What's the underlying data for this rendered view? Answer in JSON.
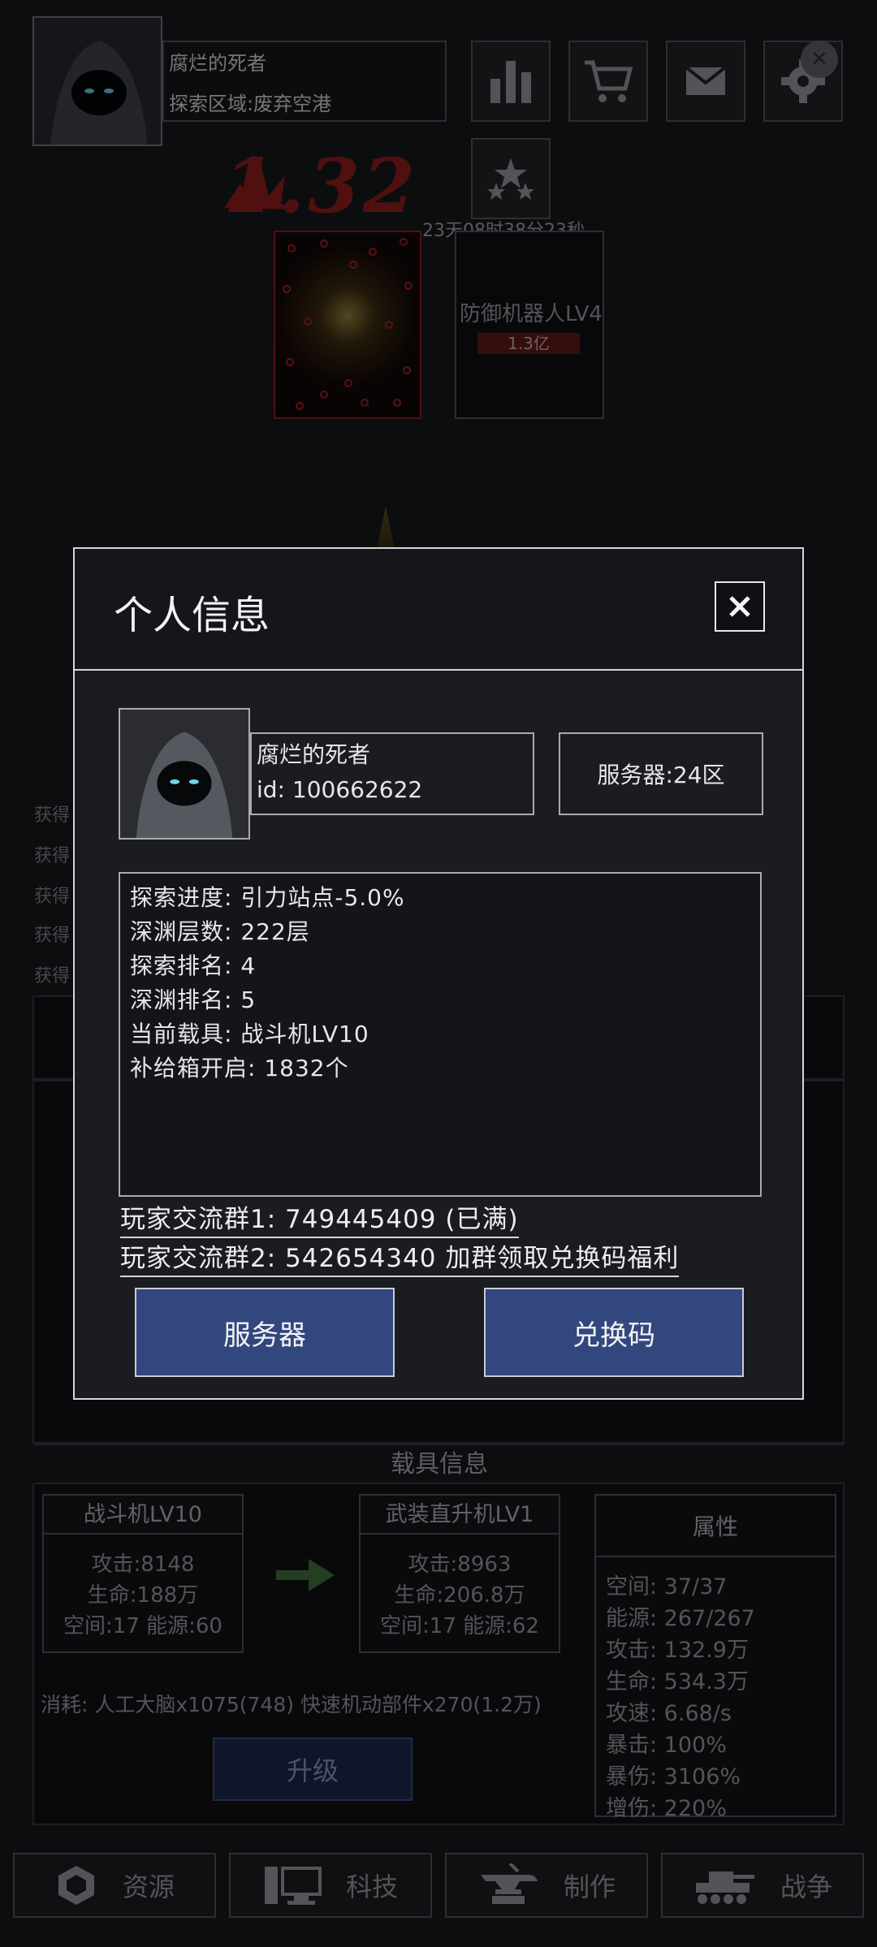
{
  "header": {
    "player_name": "腐烂的死者",
    "explore_area": "探索区域:废弃空港",
    "damage_display": "1.32",
    "countdown": "23天08时38分23秒"
  },
  "boss": {
    "name": "防御机器人LV4",
    "hp": "1.3亿"
  },
  "log": [
    "获得",
    "获得",
    "获得",
    "获得",
    "获得"
  ],
  "vehicle": {
    "section_title": "载具信息",
    "current": {
      "title": "战斗机LV10",
      "attack": "攻击:8148",
      "life": "生命:188万",
      "space_energy": "空间:17 能源:60"
    },
    "next": {
      "title": "武装直升机LV1",
      "attack": "攻击:8963",
      "life": "生命:206.8万",
      "space_energy": "空间:17 能源:62"
    },
    "attributes": {
      "title": "属性",
      "lines": [
        "空间: 37/37",
        "能源: 267/267",
        "攻击: 132.9万",
        "生命: 534.3万",
        "攻速: 6.68/s",
        "暴击: 100%",
        "暴伤: 3106%",
        "增伤: 220%"
      ]
    },
    "cost": "消耗: 人工大脑x1075(748) 快速机动部件x270(1.2万)",
    "upgrade_label": "升级"
  },
  "bottom_nav": [
    {
      "label": "资源",
      "icon": "resource-icon"
    },
    {
      "label": "科技",
      "icon": "computer-icon"
    },
    {
      "label": "制作",
      "icon": "anvil-icon"
    },
    {
      "label": "战争",
      "icon": "tank-icon"
    }
  ],
  "modal": {
    "title": "个人信息",
    "name": "腐烂的死者",
    "id_line": "id: 100662622",
    "server": "服务器:24区",
    "info": [
      "探索进度: 引力站点-5.0%",
      "深渊层数: 222层",
      "探索排名: 4",
      "深渊排名: 5",
      "当前载具: 战斗机LV10",
      "补给箱开启: 1832个"
    ],
    "group1": "玩家交流群1: 749445409 (已满)",
    "group2": "玩家交流群2: 542654340  加群领取兑换码福利",
    "btn_server": "服务器",
    "btn_code": "兑换码"
  },
  "colors": {
    "modal_button": "#33477f",
    "damage_red": "#8b1d1d",
    "upgrade_button": "#1c2748"
  }
}
